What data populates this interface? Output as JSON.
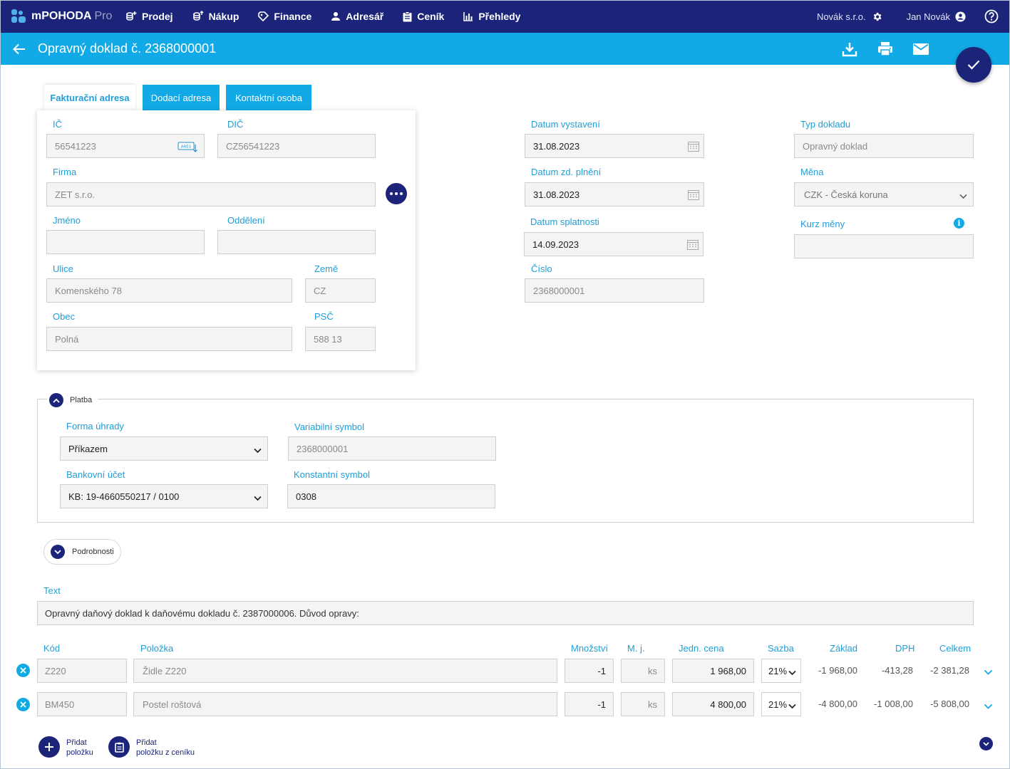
{
  "app": {
    "name": "mPOHODA",
    "edition": "Pro"
  },
  "nav": [
    {
      "key": "prodej",
      "label": "Prodej",
      "icon": "sales-icon"
    },
    {
      "key": "nakup",
      "label": "Nákup",
      "icon": "purchase-icon"
    },
    {
      "key": "finance",
      "label": "Finance",
      "icon": "finance-icon"
    },
    {
      "key": "adresar",
      "label": "Adresář",
      "icon": "person-icon"
    },
    {
      "key": "cenik",
      "label": "Ceník",
      "icon": "clipboard-icon"
    },
    {
      "key": "prehledy",
      "label": "Přehledy",
      "icon": "bar-chart-icon"
    }
  ],
  "header_right": {
    "company": "Novák s.r.o.",
    "user": "Jan Novák"
  },
  "page": {
    "title": "Opravný doklad č. 2368000001"
  },
  "colors": {
    "navy": "#1b2479",
    "accent": "#12a9e7",
    "label": "#1f9ed8"
  },
  "address_tabs": {
    "billing": "Fakturační adresa",
    "delivery": "Dodací adresa",
    "contact": "Kontaktní osoba"
  },
  "address": {
    "ic_label": "IČ",
    "ic": "56541223",
    "dic_label": "DIČ",
    "dic": "CZ56541223",
    "firma_label": "Firma",
    "firma": "ZET s.r.o.",
    "jmeno_label": "Jméno",
    "jmeno": "",
    "oddeleni_label": "Oddělení",
    "oddeleni": "",
    "ulice_label": "Ulice",
    "ulice": "Komenského 78",
    "zeme_label": "Země",
    "zeme": "CZ",
    "obec_label": "Obec",
    "obec": "Polná",
    "psc_label": "PSČ",
    "psc": "588 13",
    "ares_badge": "ARES"
  },
  "dates": {
    "vystaveni_label": "Datum vystavení",
    "vystaveni": "31.08.2023",
    "plneni_label": "Datum zd. plnění",
    "plneni": "31.08.2023",
    "splatnosti_label": "Datum splatnosti",
    "splatnosti": "14.09.2023",
    "cislo_label": "Číslo",
    "cislo": "2368000001"
  },
  "doc": {
    "typ_label": "Typ dokladu",
    "typ": "Opravný doklad",
    "mena_label": "Měna",
    "mena": "CZK - Česká koruna",
    "kurz_label": "Kurz měny",
    "kurz": "",
    "info_glyph": "i"
  },
  "platba": {
    "title": "Platba",
    "forma_label": "Forma úhrady",
    "forma": "Příkazem",
    "vs_label": "Variabilní symbol",
    "vs": "2368000001",
    "ucet_label": "Bankovní účet",
    "ucet": "KB: 19-4660550217 / 0100",
    "ks_label": "Konstantní symbol",
    "ks": "0308"
  },
  "podrobnosti": {
    "title": "Podrobnosti"
  },
  "text": {
    "label": "Text",
    "value": "Opravný daňový doklad k daňovému dokladu č. 2387000006. Důvod opravy:"
  },
  "items": {
    "headers": {
      "kod": "Kód",
      "polozka": "Položka",
      "mnozstvi": "Množství",
      "mj": "M. j.",
      "cena": "Jedn. cena",
      "sazba": "Sazba",
      "zaklad": "Základ",
      "dph": "DPH",
      "celkem": "Celkem"
    },
    "rows": [
      {
        "kod": "Z220",
        "polozka": "Židle Z220",
        "mnozstvi": "-1",
        "mj": "ks",
        "cena": "1 968,00",
        "sazba": "21%",
        "zaklad": "-1 968,00",
        "dph": "-413,28",
        "celkem": "-2 381,28"
      },
      {
        "kod": "BM450",
        "polozka": "Postel roštová",
        "mnozstvi": "-1",
        "mj": "ks",
        "cena": "4 800,00",
        "sazba": "21%",
        "zaklad": "-4 800,00",
        "dph": "-1 008,00",
        "celkem": "-5 808,00"
      }
    ]
  },
  "footer_buttons": {
    "add_item_1": "Přidat",
    "add_item_2": "položku",
    "add_pricelist_1": "Přidat",
    "add_pricelist_2": "položku z ceníku"
  }
}
